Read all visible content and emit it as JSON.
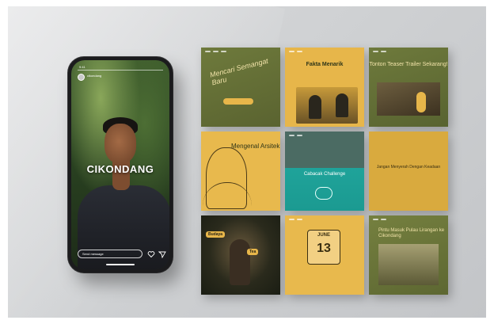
{
  "phone": {
    "status_time": "9:41",
    "user_name": "cikondang",
    "story_title": "CIKONDANG",
    "message_placeholder": "Send message",
    "icons": [
      "heart-icon",
      "send-icon"
    ]
  },
  "posts": [
    {
      "headline": "Mencari Semangat Baru",
      "pill": ""
    },
    {
      "headline": "Fakta Menarik"
    },
    {
      "headline": "Tonton Teaser Trailer Sekarang!"
    },
    {
      "headline": "Mengenal Arsitek"
    },
    {
      "headline": "Cabacak Challenge"
    },
    {
      "headline": "Jangan Menyerah Dengan Keadaan"
    },
    {
      "tags": [
        "Budaya",
        "Tea"
      ]
    },
    {
      "calendar_month": "JUNE",
      "calendar_day": "13"
    },
    {
      "headline": "Pintu Masuk Pulau Lirangan ke Cikondang"
    }
  ],
  "colors": {
    "olive": "#6e7a3c",
    "mustard": "#e7b64a",
    "teal": "#1fa39a",
    "cream_text": "#f0e2a8"
  }
}
